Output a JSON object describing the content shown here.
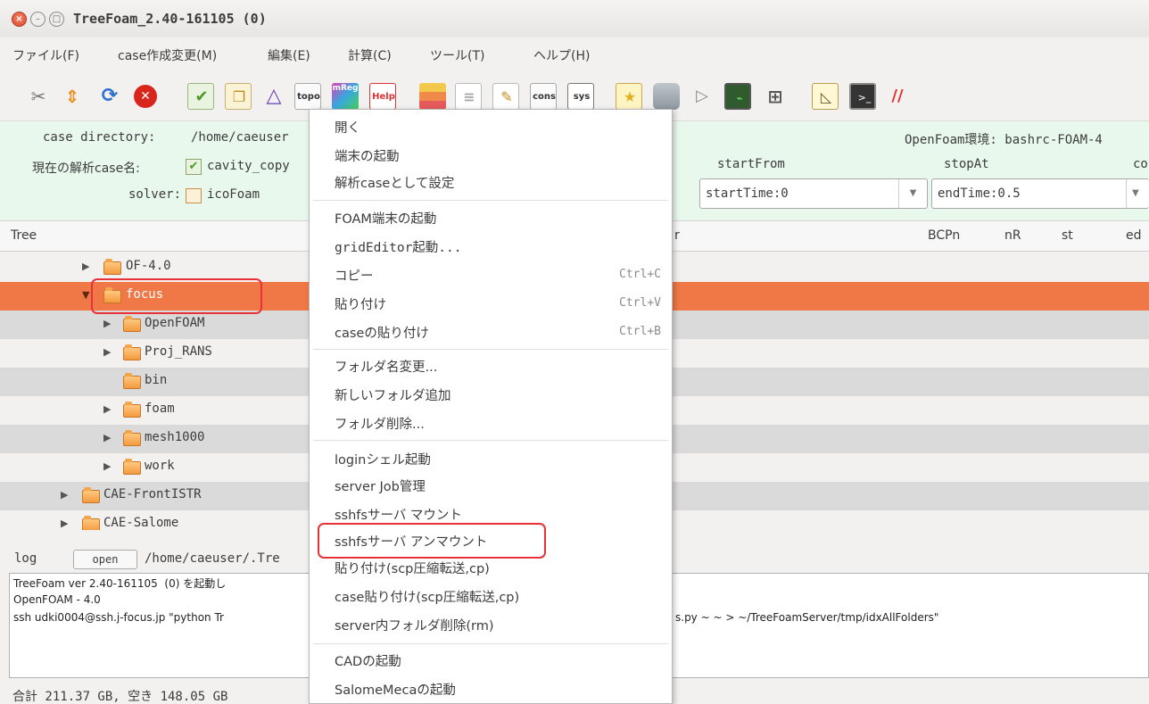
{
  "window": {
    "title": "TreeFoam_2.40-161105 (0)"
  },
  "menubar": [
    "ファイル(F)",
    "case作成変更(M)",
    "編集(E)",
    "計算(C)",
    "ツール(T)",
    "ヘルプ(H)"
  ],
  "toolbar": {
    "icons": [
      "scissors-tool-icon",
      "up-down-arrows-icon",
      "refresh-icon",
      "stop-icon",
      "check-doc-icon",
      "copy-doc-icon",
      "mesh-triangle-icon",
      "topo-icon",
      "mreg-icon",
      "help-icon",
      "grid-table-icon",
      "blank-doc-icon",
      "edit-doc-icon",
      "cons-icon",
      "sys-icon",
      "star-folder-icon",
      "database-icon",
      "play-icon",
      "monitor-icon",
      "layout-icon",
      "ruler-icon",
      "terminal-icon",
      "bars-icon"
    ],
    "labels": {
      "topo": "topo",
      "mreg": "mReg",
      "help": "Help",
      "cons": "cons",
      "sys": "sys"
    },
    "colors": {
      "stop": "#d9261c",
      "refresh": "#2e6fd0",
      "accent": "#f07846"
    }
  },
  "info": {
    "case_dir_label": "case directory:",
    "case_dir_value": "/home/caeuser",
    "case_name_label": "現在の解析case名:",
    "case_name_value": "cavity_copy",
    "solver_label": "solver:",
    "solver_value": "icoFoam",
    "env_label": "OpenFoam環境: bashrc-FOAM-4",
    "startFrom_label": "startFrom",
    "startFrom_value": "startTime:0",
    "stopAt_label": "stopAt",
    "stopAt_value": "endTime:0.5",
    "extra_label": "co"
  },
  "tree": {
    "headers": {
      "tree": "Tree",
      "col2": "r",
      "bcpn": "BCPn",
      "nr": "nR",
      "st": "st",
      "ed": "ed"
    },
    "rows": [
      {
        "label": "OF-4.0"
      },
      {
        "label": "focus"
      },
      {
        "label": "OpenFOAM"
      },
      {
        "label": "Proj_RANS"
      },
      {
        "label": "bin"
      },
      {
        "label": "foam"
      },
      {
        "label": "mesh1000"
      },
      {
        "label": "work"
      },
      {
        "label": "CAE-FrontISTR"
      },
      {
        "label": "CAE-Salome"
      }
    ]
  },
  "log": {
    "label": "log",
    "open_button": "open",
    "path": "/home/caeuser/.Tre",
    "lines": [
      "TreeFoam ver 2.40-161105  (0) を起動し",
      "OpenFOAM - 4.0",
      "ssh udki0004@ssh.j-focus.jp \"python Tr",
      "s.py ~ ~ > ~/TreeFoamServer/tmp/idxAllFolders\""
    ]
  },
  "status": "合計 211.37 GB,  空き 148.05 GB",
  "context_menu": {
    "groups": [
      [
        {
          "label": "開く"
        },
        {
          "label": "端末の起動"
        },
        {
          "label": "解析caseとして設定"
        }
      ],
      [
        {
          "label": "FOAM端末の起動"
        },
        {
          "label": "gridEditor起動..."
        },
        {
          "label": "コピー",
          "shortcut": "Ctrl+C"
        },
        {
          "label": "貼り付け",
          "shortcut": "Ctrl+V"
        },
        {
          "label": "caseの貼り付け",
          "shortcut": "Ctrl+B"
        }
      ],
      [
        {
          "label": "フォルダ名変更..."
        },
        {
          "label": "新しいフォルダ追加"
        },
        {
          "label": "フォルダ削除..."
        }
      ],
      [
        {
          "label": "loginシェル起動"
        },
        {
          "label": "server Job管理"
        },
        {
          "label": "sshfsサーバ マウント"
        },
        {
          "label": "sshfsサーバ アンマウント"
        },
        {
          "label": "貼り付け(scp圧縮転送,cp)"
        },
        {
          "label": "case貼り付け(scp圧縮転送,cp)"
        },
        {
          "label": "server内フォルダ削除(rm)"
        }
      ],
      [
        {
          "label": "CADの起動"
        },
        {
          "label": "SalomeMecaの起動"
        }
      ]
    ]
  }
}
